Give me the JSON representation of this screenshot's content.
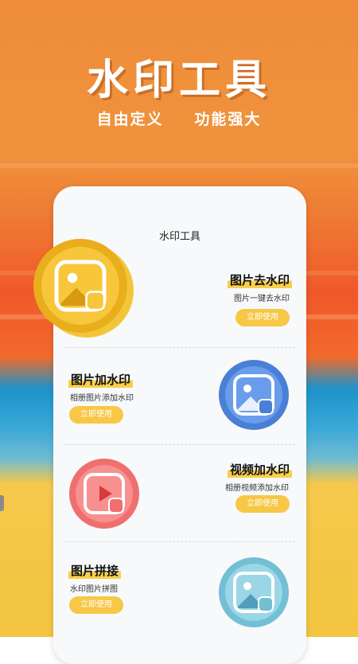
{
  "hero": {
    "title": "水印工具",
    "subtitle_left": "自由定义",
    "subtitle_right": "功能强大"
  },
  "app": {
    "title": "水印工具"
  },
  "features": [
    {
      "title": "图片去水印",
      "desc": "图片一键去水印",
      "button": "立即使用",
      "icon": "image-remove-watermark-icon"
    },
    {
      "title": "图片加水印",
      "desc": "相册图片添加水印",
      "button": "立即使用",
      "icon": "image-add-watermark-icon"
    },
    {
      "title": "视频加水印",
      "desc": "相册视频添加水印",
      "button": "立即使用",
      "icon": "video-watermark-icon"
    },
    {
      "title": "图片拼接",
      "desc": "水印图片拼图",
      "button": "立即使用",
      "icon": "image-stitch-icon"
    }
  ],
  "colors": {
    "accent": "#f7c746",
    "gold_coin": "#f5c02c",
    "blue_coin": "#5a8fe6",
    "red_coin": "#f58585",
    "teal_coin": "#8fd0e0"
  }
}
